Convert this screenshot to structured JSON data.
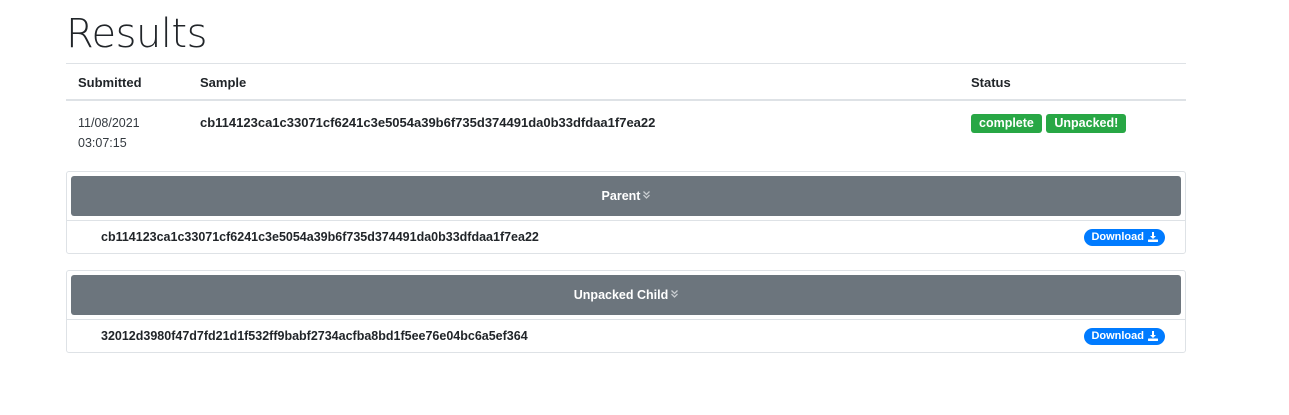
{
  "page": {
    "title": "Results"
  },
  "table": {
    "headers": {
      "submitted": "Submitted",
      "sample": "Sample",
      "status": "Status"
    },
    "rows": [
      {
        "date": "11/08/2021",
        "time": "03:07:15",
        "sample": "cb114123ca1c33071cf6241c3e5054a39b6f735d374491da0b33dfdaa1f7ea22",
        "badges": [
          "complete",
          "Unpacked!"
        ]
      }
    ]
  },
  "cards": [
    {
      "header": "Parent",
      "hash": "cb114123ca1c33071cf6241c3e5054a39b6f735d374491da0b33dfdaa1f7ea22",
      "download_label": "Download"
    },
    {
      "header": "Unpacked Child",
      "hash": "32012d3980f47d7fd21d1f532ff9babf2734acfba8bd1f5ee76e04bc6a5ef364",
      "download_label": "Download"
    }
  ],
  "icons": {
    "chevron": "double-chevron-down-icon",
    "download": "download-icon"
  },
  "colors": {
    "badge_success": "#28a745",
    "card_header": "#6c757d",
    "download_button": "#007bff"
  }
}
